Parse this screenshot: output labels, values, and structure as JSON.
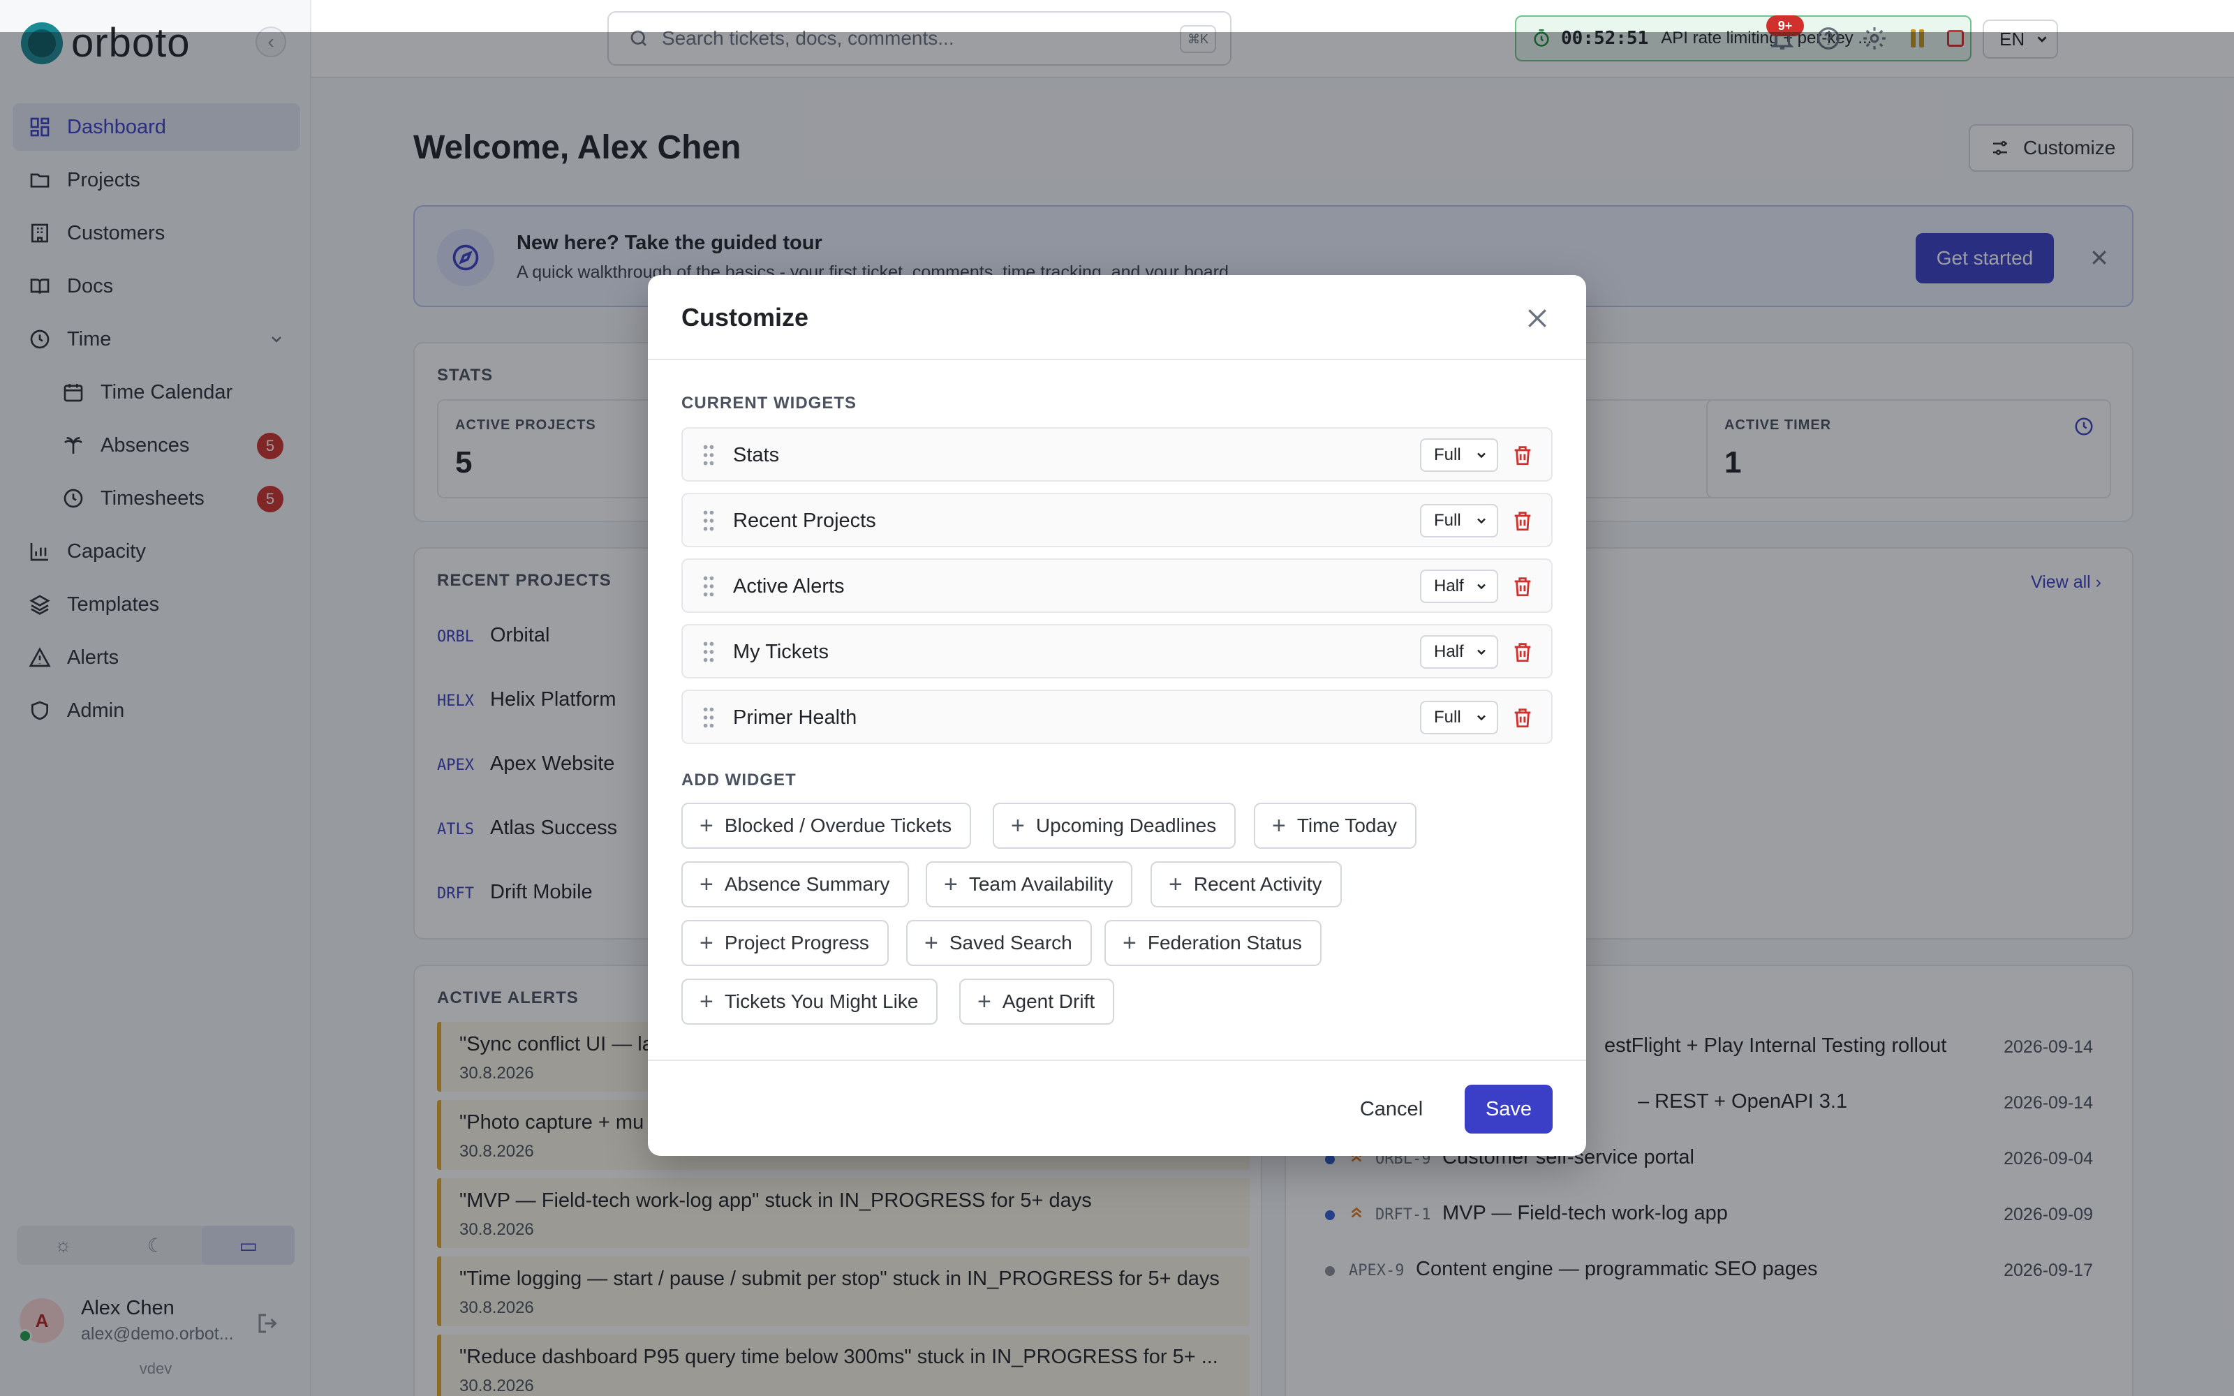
{
  "app": {
    "brand": "orboto",
    "version": "vdev"
  },
  "sidebar": {
    "items": [
      {
        "label": "Dashboard"
      },
      {
        "label": "Projects"
      },
      {
        "label": "Customers"
      },
      {
        "label": "Docs"
      },
      {
        "label": "Time"
      },
      {
        "label": "Time Calendar"
      },
      {
        "label": "Absences",
        "badge": "5"
      },
      {
        "label": "Timesheets",
        "badge": "5"
      },
      {
        "label": "Capacity"
      },
      {
        "label": "Templates"
      },
      {
        "label": "Alerts"
      },
      {
        "label": "Admin"
      }
    ],
    "user": {
      "initial": "A",
      "name": "Alex Chen",
      "email": "alex@demo.orbot..."
    }
  },
  "topbar": {
    "search_placeholder": "Search tickets, docs, comments...",
    "search_shortcut": "⌘K",
    "timer_time": "00:52:51",
    "timer_task": "API rate limiting + per-key ...",
    "language": "EN",
    "notification_count": "9+"
  },
  "main": {
    "welcome": "Welcome, Alex Chen",
    "customize_label": "Customize",
    "tour": {
      "title": "New here? Take the guided tour",
      "subtitle": "A quick walkthrough of the basics - your first ticket, comments, time tracking, and your board.",
      "button": "Get started"
    },
    "stats": {
      "title": "STATS",
      "items": [
        {
          "label": "ACTIVE PROJECTS",
          "value": "5"
        },
        {
          "label": "ACTIVE TIMER",
          "value": "1"
        }
      ]
    },
    "recent_projects": {
      "title": "RECENT PROJECTS",
      "view_all": "View all",
      "items": [
        {
          "key": "ORBL",
          "name": "Orbital"
        },
        {
          "key": "HELX",
          "name": "Helix Platform"
        },
        {
          "key": "APEX",
          "name": "Apex Website"
        },
        {
          "key": "ATLS",
          "name": "Atlas Success"
        },
        {
          "key": "DRFT",
          "name": "Drift Mobile"
        }
      ]
    },
    "active_alerts": {
      "title": "ACTIVE ALERTS",
      "items": [
        {
          "text": "\"Sync conflict UI — la",
          "date": "30.8.2026"
        },
        {
          "text": "\"Photo capture + mu",
          "date": "30.8.2026"
        },
        {
          "text": "\"MVP — Field-tech work-log app\" stuck in IN_PROGRESS for 5+ days",
          "date": "30.8.2026"
        },
        {
          "text": "\"Time logging — start / pause / submit per stop\" stuck in IN_PROGRESS for 5+ days",
          "date": "30.8.2026"
        },
        {
          "text": "\"Reduce dashboard P95 query time below 300ms\" stuck in IN_PROGRESS for 5+ ...",
          "date": "30.8.2026"
        }
      ]
    },
    "tickets": {
      "items": [
        {
          "key": "",
          "title": "estFlight + Play Internal Testing rollout",
          "date": "2026-09-14"
        },
        {
          "key": "",
          "title": "– REST + OpenAPI 3.1",
          "date": "2026-09-14"
        },
        {
          "key": "ORBL-9",
          "title": "Customer self-service portal",
          "date": "2026-09-04"
        },
        {
          "key": "DRFT-1",
          "title": "MVP — Field-tech work-log app",
          "date": "2026-09-09"
        },
        {
          "key": "APEX-9",
          "title": "Content engine — programmatic SEO pages",
          "date": "2026-09-17"
        }
      ]
    }
  },
  "modal": {
    "title": "Customize",
    "current_label": "CURRENT WIDGETS",
    "add_label": "ADD WIDGET",
    "widgets": [
      {
        "name": "Stats",
        "size": "Full"
      },
      {
        "name": "Recent Projects",
        "size": "Full"
      },
      {
        "name": "Active Alerts",
        "size": "Half"
      },
      {
        "name": "My Tickets",
        "size": "Half"
      },
      {
        "name": "Primer Health",
        "size": "Full"
      }
    ],
    "available": [
      "Blocked / Overdue Tickets",
      "Upcoming Deadlines",
      "Time Today",
      "Absence Summary",
      "Team Availability",
      "Recent Activity",
      "Project Progress",
      "Saved Search",
      "Federation Status",
      "Tickets You Might Like",
      "Agent Drift"
    ],
    "cancel": "Cancel",
    "save": "Save"
  }
}
